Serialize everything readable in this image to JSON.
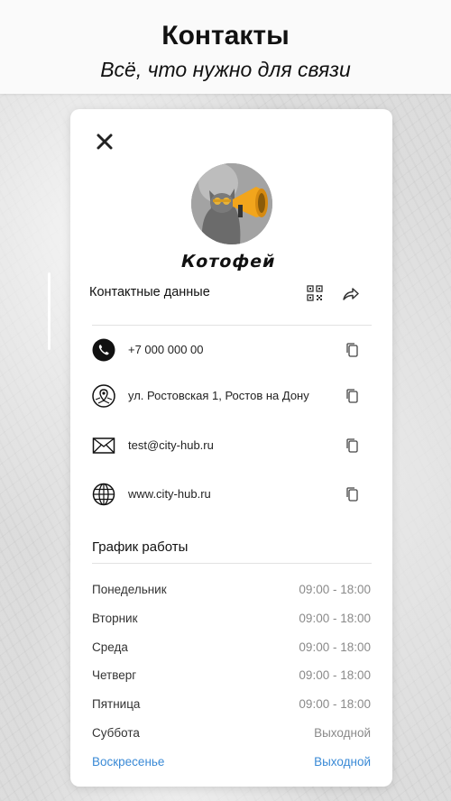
{
  "header": {
    "title": "Контакты",
    "subtitle": "Всё, что нужно для связи"
  },
  "card": {
    "brand_name": "Котофей",
    "contacts_title": "Контактные данные",
    "contacts": [
      {
        "icon": "phone-icon",
        "value": "+7 000 000 00"
      },
      {
        "icon": "map-pin-icon",
        "value": "ул. Ростовская 1,  Ростов на Дону"
      },
      {
        "icon": "mail-icon",
        "value": "test@city-hub.ru"
      },
      {
        "icon": "globe-icon",
        "value": "www.city-hub.ru"
      }
    ],
    "schedule_title": "График работы",
    "schedule": [
      {
        "day": "Понедельник",
        "time": "09:00 - 18:00"
      },
      {
        "day": "Вторник",
        "time": "09:00 - 18:00"
      },
      {
        "day": "Среда",
        "time": "09:00 - 18:00"
      },
      {
        "day": "Четверг",
        "time": "09:00 - 18:00"
      },
      {
        "day": "Пятница",
        "time": "09:00 - 18:00"
      },
      {
        "day": "Суббота",
        "time": "Выходной"
      },
      {
        "day": "Воскресенье",
        "time": "Выходной",
        "highlight": true
      }
    ]
  },
  "colors": {
    "accent": "#3a8ad6",
    "megaphone": "#f2a51c"
  }
}
